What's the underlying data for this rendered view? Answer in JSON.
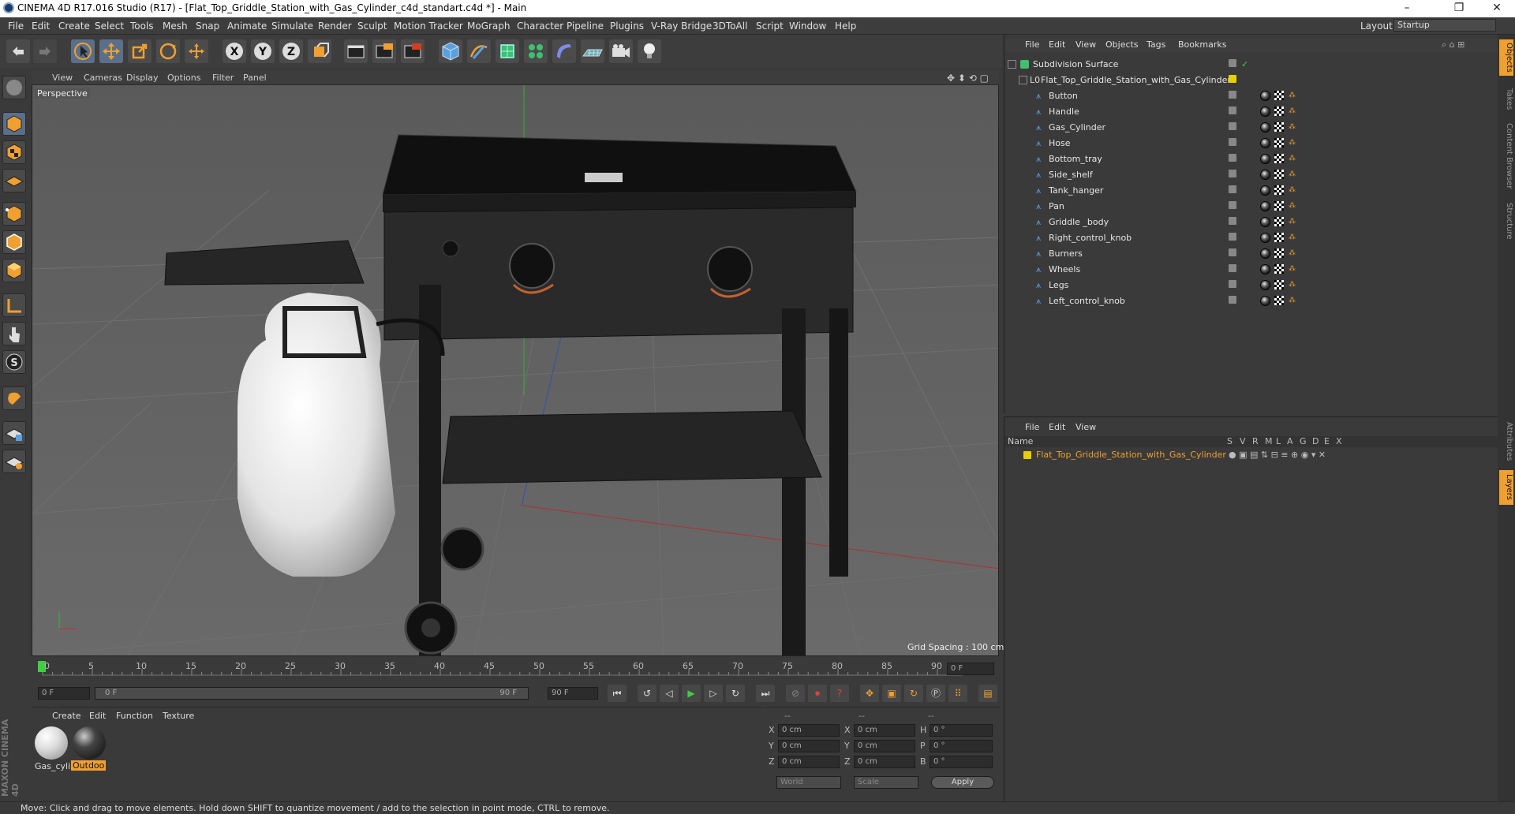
{
  "titlebar": {
    "title": "CINEMA 4D R17.016 Studio (R17) - [Flat_Top_Griddle_Station_with_Gas_Cylinder_c4d_standart.c4d *] - Main",
    "minimize": "–",
    "maximize": "❐",
    "close": "✕"
  },
  "menubar": {
    "items": [
      "File",
      "Edit",
      "Create",
      "Select",
      "Tools",
      "Mesh",
      "Snap",
      "Animate",
      "Simulate",
      "Render",
      "Sculpt",
      "Motion Tracker",
      "MoGraph",
      "Character",
      "Pipeline",
      "Plugins",
      "V-Ray Bridge",
      "3DToAll",
      "Script",
      "Window",
      "Help"
    ],
    "layout_label": "Layout:",
    "layout_value": "Startup"
  },
  "viewport": {
    "menu": [
      "View",
      "Cameras",
      "Display",
      "Options",
      "Filter",
      "Panel"
    ],
    "camera_label": "Perspective",
    "grid_spacing": "Grid Spacing : 100 cm"
  },
  "timeline": {
    "ticks": [
      "0",
      "5",
      "10",
      "15",
      "20",
      "25",
      "30",
      "35",
      "40",
      "45",
      "50",
      "55",
      "60",
      "65",
      "70",
      "75",
      "80",
      "85",
      "90"
    ],
    "current_frame": "0 F",
    "start_field": "0 F",
    "range_start": "0 F",
    "range_end": "90 F",
    "end_field": "90 F"
  },
  "materials": {
    "menu": [
      "Create",
      "Edit",
      "Function",
      "Texture"
    ],
    "items": [
      {
        "label": "Gas_cyli",
        "selected": false
      },
      {
        "label": "Outdoo",
        "selected": true
      }
    ]
  },
  "coords": {
    "col_headers": [
      "--",
      "--",
      "--"
    ],
    "rows": [
      {
        "a": "X",
        "av": "0 cm",
        "b": "X",
        "bv": "0 cm",
        "c": "H",
        "cv": "0 °"
      },
      {
        "a": "Y",
        "av": "0 cm",
        "b": "Y",
        "bv": "0 cm",
        "c": "P",
        "cv": "0 °"
      },
      {
        "a": "Z",
        "av": "0 cm",
        "b": "Z",
        "bv": "0 cm",
        "c": "B",
        "cv": "0 °"
      }
    ],
    "world": "World",
    "scale": "Scale",
    "apply": "Apply"
  },
  "object_manager": {
    "menu": [
      "File",
      "Edit",
      "View",
      "Objects",
      "Tags",
      "Bookmarks"
    ],
    "root": "Subdivision Surface",
    "group": "Flat_Top_Griddle_Station_with_Gas_Cylinder",
    "children": [
      "Button",
      "Handle",
      "Gas_Cylinder",
      "Hose",
      "Bottom_tray",
      "Side_shelf",
      "Tank_hanger",
      "Pan",
      "Griddle _body",
      "Right_control_knob",
      "Burners",
      "Wheels",
      "Legs",
      "Left_control_knob"
    ]
  },
  "attribute_manager": {
    "menu": [
      "File",
      "Edit",
      "View"
    ],
    "col_name": "Name",
    "col_flags": [
      "S",
      "V",
      "R",
      "M",
      "L",
      "A",
      "G",
      "D",
      "E",
      "X"
    ],
    "layer_name": "Flat_Top_Griddle_Station_with_Gas_Cylinder"
  },
  "side_tabs": [
    "Objects",
    "Takes",
    "Content Browser",
    "Structure",
    "Attributes",
    "Layers"
  ],
  "status": "Move: Click and drag to move elements. Hold down SHIFT to quantize movement / add to the selection in point mode, CTRL to remove.",
  "brand": "MAXON CINEMA 4D",
  "colors": {
    "accent_orange": "#f0a030",
    "layer_yellow": "#e8d000",
    "play_green": "#3fcf3f"
  }
}
